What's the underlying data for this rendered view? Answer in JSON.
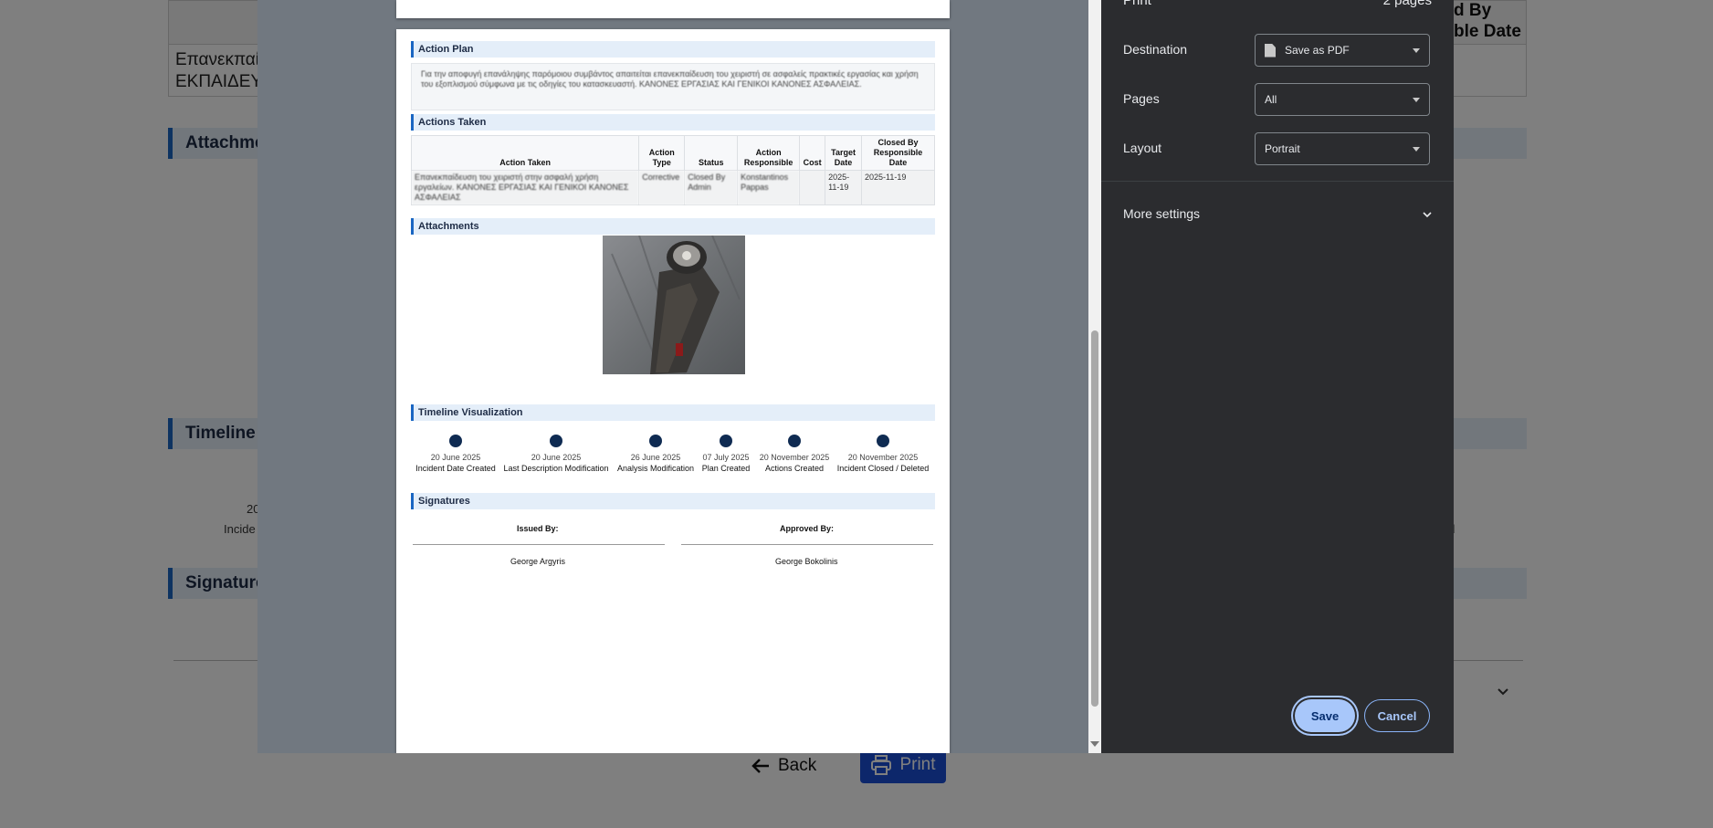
{
  "background": {
    "greek_text": "Επανεκπαίδ\nΕΚΠΑΙΔΕΥ",
    "closed_header": "d By\nble Date",
    "sections": [
      "Attachme",
      "Timeline V",
      "Signature"
    ],
    "timeline_left_date": "20",
    "timeline_left_label": "Incide",
    "timeline_right_date": "5",
    "timeline_right_label": "eted",
    "back_label": "Back",
    "print_label": "Print"
  },
  "dialog": {
    "title": "Print",
    "page_count": "2 pages",
    "destination_label": "Destination",
    "destination_value": "Save as PDF",
    "pages_label": "Pages",
    "pages_value": "All",
    "layout_label": "Layout",
    "layout_value": "Portrait",
    "more_settings": "More settings",
    "save": "Save",
    "cancel": "Cancel"
  },
  "document": {
    "action_plan_title": "Action Plan",
    "action_plan_text": "Για την αποφυγή επανάληψης παρόμοιου συμβάντος απαιτείται επανεκπαίδευση του χειριστή σε ασφαλείς πρακτικές εργασίας και χρήση του εξοπλισμού σύμφωνα με τις οδηγίες του κατασκευαστή. ΚΑΝΟΝΕΣ ΕΡΓΑΣΙΑΣ ΚΑΙ ΓΕΝΙΚΟΙ ΚΑΝΟΝΕΣ ΑΣΦΑΛΕΙΑΣ.",
    "actions_taken_title": "Actions Taken",
    "columns": [
      "Action Taken",
      "Action Type",
      "Status",
      "Action Responsible",
      "Cost",
      "Target Date",
      "Closed By Responsible Date"
    ],
    "rows": [
      {
        "action": "Επανεκπαίδευση του χειριστή στην ασφαλή χρήση εργαλείων. ΚΑΝΟΝΕΣ ΕΡΓΑΣΙΑΣ ΚΑΙ ΓΕΝΙΚΟΙ ΚΑΝΟΝΕΣ ΑΣΦΑΛΕΙΑΣ",
        "type": "Corrective",
        "status": "Closed By Admin",
        "responsible": "Konstantinos Pappas",
        "cost": "",
        "target": "2025-11-19",
        "closed": "2025-11-19"
      }
    ],
    "attachments_title": "Attachments",
    "timeline_title": "Timeline Visualization",
    "timeline": [
      {
        "date": "20 June 2025",
        "label": "Incident Date Created"
      },
      {
        "date": "20 June 2025",
        "label": "Last Description Modification"
      },
      {
        "date": "26 June 2025",
        "label": "Analysis Modification"
      },
      {
        "date": "07 July 2025",
        "label": "Plan Created"
      },
      {
        "date": "20 November 2025",
        "label": "Actions Created"
      },
      {
        "date": "20 November 2025",
        "label": "Incident Closed / Deleted"
      }
    ],
    "signatures_title": "Signatures",
    "issued_by_label": "Issued By:",
    "issued_by_name": "George Argyris",
    "approved_by_label": "Approved By:",
    "approved_by_name": "George Bokolinis"
  },
  "icons": {
    "destination": "pdf-document-icon",
    "more_settings": "chevron-down-icon",
    "back": "arrow-left-icon",
    "print": "printer-icon"
  },
  "colors": {
    "accent": "#1a66c2",
    "timeline_dot": "#0f2b52",
    "save_button": "#a8c7fa",
    "panel_bg": "#2b2c2f"
  }
}
